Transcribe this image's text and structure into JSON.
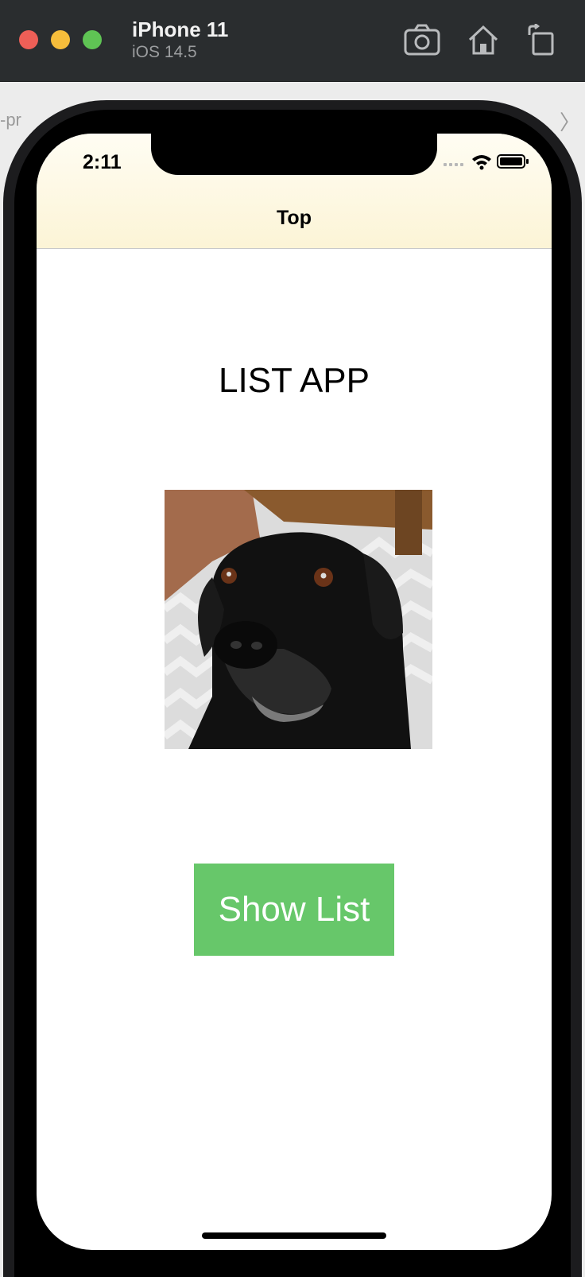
{
  "simulator": {
    "device_name": "iPhone 11",
    "os_version": "iOS 14.5",
    "toolbar_icons": [
      "screenshot-icon",
      "home-icon",
      "rotate-icon"
    ]
  },
  "background": {
    "partial_text": "-pr",
    "chevron": "〉"
  },
  "status_bar": {
    "time": "2:11"
  },
  "nav": {
    "title": "Top"
  },
  "main": {
    "app_title": "LIST APP",
    "image_subject": "black labrador dog",
    "button_label": "Show List"
  },
  "colors": {
    "header_bg": "#fcf4d6",
    "button_bg": "#67c76a",
    "titlebar_bg": "#2a2d2f"
  }
}
